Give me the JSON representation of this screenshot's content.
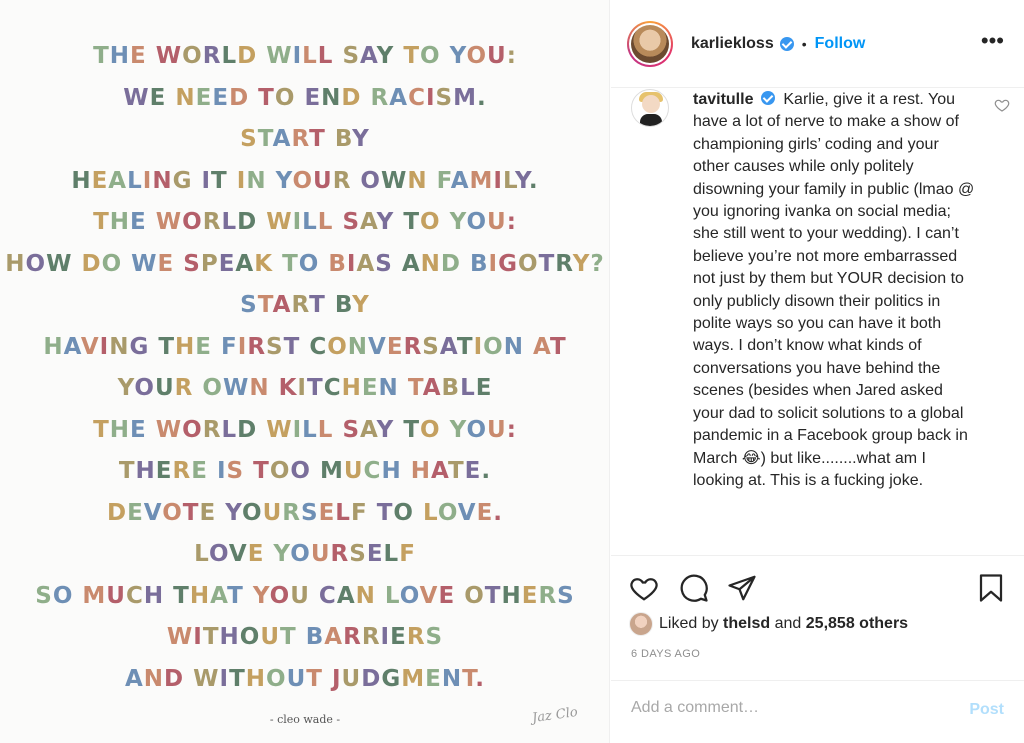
{
  "poem": {
    "lines": [
      "THE WORLD WILL SAY TO YOU:",
      "WE NEED TO END RACISM.",
      "START BY",
      "HEALING IT IN YOUR OWN FAMILY.",
      "THE WORLD WILL SAY TO YOU:",
      "HOW DO WE SPEAK TO BIAS AND BIGOTRY?",
      "START BY",
      "HAVING THE FIRST CONVERSATION AT",
      "YOUR OWN KITCHEN TABLE",
      "THE WORLD WILL SAY TO YOU:",
      "THERE IS TOO MUCH HATE.",
      "DEVOTE YOURSELF TO LOVE.",
      "LOVE YOURSELF",
      "SO MUCH THAT YOU CAN LOVE OTHERS",
      "WITHOUT BARRIERS",
      "AND WITHOUT JUDGMENT."
    ],
    "attribution": "- cleo wade -",
    "signature": "Jaz Clo",
    "letter_colors": [
      "#8fae8a",
      "#6e8fb5",
      "#c98a6e",
      "#b45f6a",
      "#a99a6a",
      "#7a6e9a",
      "#5f7f6a",
      "#c4a060"
    ]
  },
  "header": {
    "username": "karliekloss",
    "separator": "•",
    "follow_label": "Follow",
    "more_label": "•••"
  },
  "comment": {
    "username": "tavitulle",
    "text": "Karlie, give it a rest. You have a lot of nerve to make a show of championing girls’ coding and your other causes while only politely disowning your family in public (lmao @ you ignoring ivanka on social media; she still went to your wedding). I can’t believe you’re not more embarrassed not just by them but YOUR decision to only publicly disown their politics in polite ways so you can have it both ways. I don’t know what kinds of conversations you have behind the scenes (besides when Jared asked your dad to solicit solutions to a global pandemic in a Facebook group back in March 😂) but like........what am I looking at. This is a fucking joke."
  },
  "likes": {
    "prefix": "Liked by",
    "user": "thelsd",
    "middle": "and",
    "others": "25,858 others"
  },
  "date": "6 DAYS AGO",
  "comment_box": {
    "placeholder": "Add a comment…",
    "post_label": "Post"
  },
  "colors": {
    "accent": "#0095f6",
    "verified": "#3897f0",
    "post_disabled": "#b2dffc"
  }
}
